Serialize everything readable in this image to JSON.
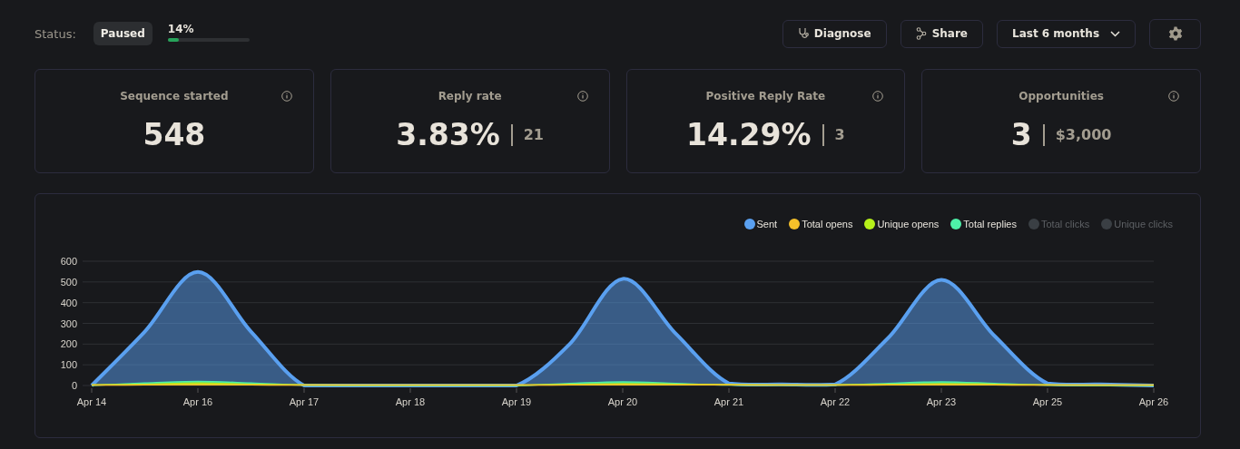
{
  "status": {
    "label": "Status:",
    "badge": "Paused",
    "progress_text": "14%",
    "level": 0.14
  },
  "toolbar": {
    "buttons": [
      {
        "kind": "diagnose",
        "label": "Diagnose"
      },
      {
        "kind": "share",
        "label": "Share"
      }
    ],
    "range_dropdown": "Last 6 months"
  },
  "cards": [
    {
      "title": "Sequence started",
      "value": "548"
    },
    {
      "title": "Reply rate",
      "value": "3.83%",
      "secondary": "21"
    },
    {
      "title": "Positive Reply Rate",
      "value": "14.29%",
      "secondary": "3"
    },
    {
      "title": "Opportunities",
      "value": "3",
      "secondary": "$3,000"
    }
  ],
  "chart": {
    "legend_extra": [
      {
        "label": "Total clicks",
        "color": "#3a3f44",
        "enabled": false
      },
      {
        "label": "Unique clicks",
        "color": "#3a3f44",
        "enabled": false
      }
    ],
    "chart_data": {
      "type": "area",
      "categories": [
        "Apr 14",
        null,
        "Apr 16",
        null,
        "Apr 17",
        null,
        "Apr 18",
        null,
        "Apr 19",
        null,
        "Apr 20",
        null,
        "Apr 21",
        null,
        "Apr 22",
        null,
        "Apr 23",
        null,
        "Apr 25",
        null,
        "Apr 26"
      ],
      "grid": true,
      "ylim": [
        0,
        600
      ],
      "yticks": [
        0,
        100,
        200,
        300,
        400,
        500,
        600
      ],
      "series": [
        {
          "name": "Sent",
          "color": "#5aa0f0",
          "values": [
            0,
            260,
            548,
            260,
            0,
            0,
            0,
            0,
            0,
            200,
            515,
            250,
            10,
            5,
            5,
            230,
            510,
            240,
            10,
            5,
            0
          ]
        },
        {
          "name": "Total opens",
          "color": "#f5c02a",
          "values": [
            2,
            3,
            4,
            3,
            2,
            2,
            2,
            2,
            2,
            3,
            4,
            3,
            3,
            2,
            2,
            3,
            4,
            3,
            2,
            2,
            2
          ]
        },
        {
          "name": "Unique opens",
          "color": "#b6f01a",
          "values": [
            3,
            6,
            12,
            6,
            3,
            2,
            2,
            2,
            2,
            5,
            9,
            6,
            4,
            3,
            3,
            5,
            9,
            6,
            3,
            2,
            2
          ]
        },
        {
          "name": "Total replies",
          "color": "#4ef0a8",
          "values": [
            0,
            12,
            20,
            12,
            1,
            0,
            0,
            0,
            0,
            10,
            18,
            10,
            2,
            1,
            1,
            10,
            18,
            10,
            1,
            0,
            0
          ]
        }
      ]
    }
  }
}
